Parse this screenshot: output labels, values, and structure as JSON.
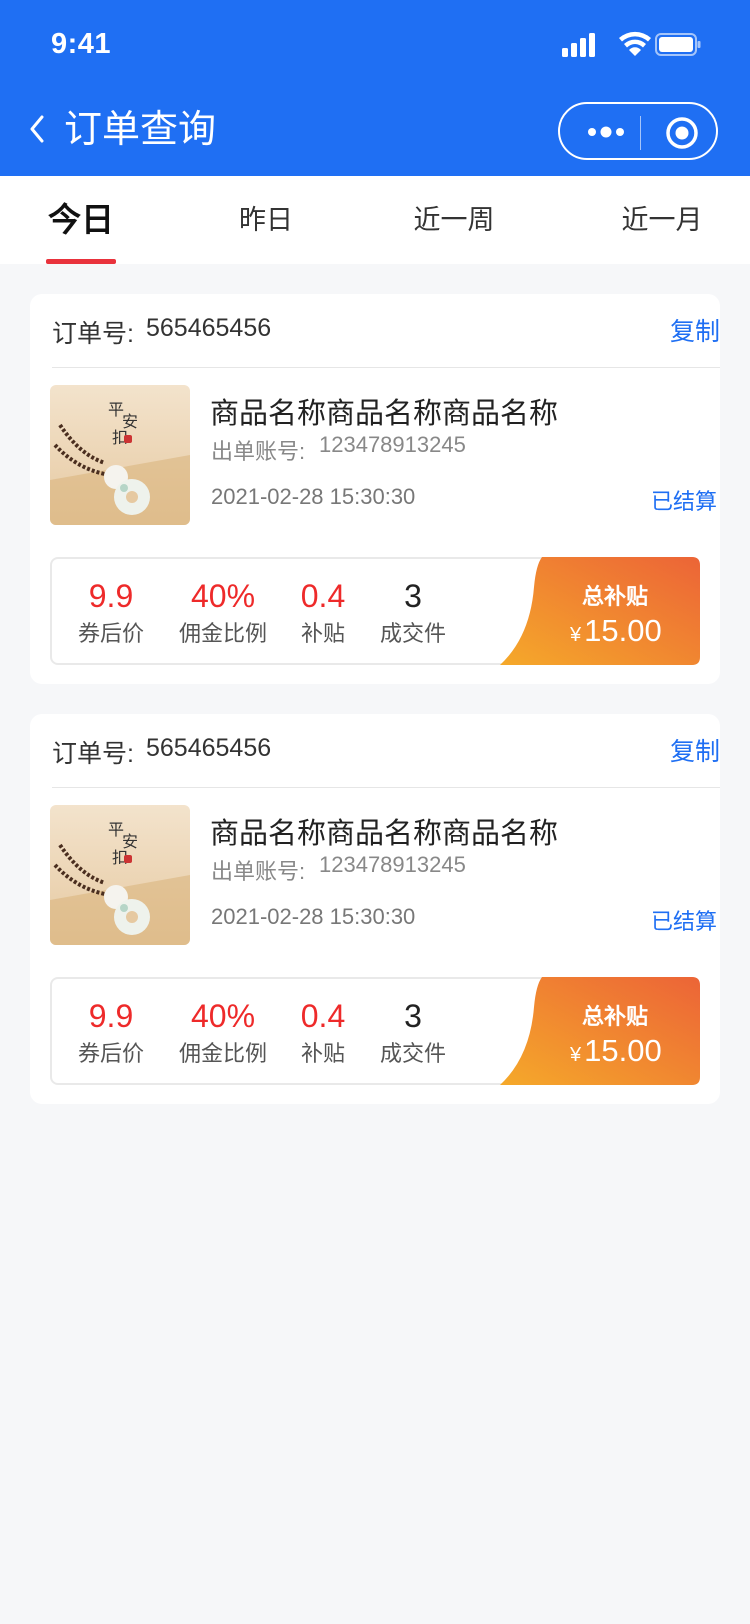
{
  "status_bar": {
    "time": "9:41"
  },
  "nav": {
    "title": "订单查询"
  },
  "tabs": [
    {
      "label": "今日",
      "active": true
    },
    {
      "label": "昨日",
      "active": false
    },
    {
      "label": "近一周",
      "active": false
    },
    {
      "label": "近一月",
      "active": false
    }
  ],
  "orders": [
    {
      "order_label": "订单号:",
      "order_no": "565465456",
      "copy_label": "复制",
      "product_name": "商品名称商品名称商品名称",
      "account_label": "出单账号:",
      "account_no": "123478913245",
      "time": "2021-02-28 15:30:30",
      "status": "已结算",
      "stats": [
        {
          "value": "9.9",
          "label": "券后价"
        },
        {
          "value": "40%",
          "label": "佣金比例"
        },
        {
          "value": "0.4",
          "label": "补贴"
        },
        {
          "value": "3",
          "label": "成交件"
        }
      ],
      "subsidy_label": "总补贴",
      "subsidy_currency": "¥",
      "subsidy_amount": "15.00"
    },
    {
      "order_label": "订单号:",
      "order_no": "565465456",
      "copy_label": "复制",
      "product_name": "商品名称商品名称商品名称",
      "account_label": "出单账号:",
      "account_no": "123478913245",
      "time": "2021-02-28 15:30:30",
      "status": "已结算",
      "stats": [
        {
          "value": "9.9",
          "label": "券后价"
        },
        {
          "value": "40%",
          "label": "佣金比例"
        },
        {
          "value": "0.4",
          "label": "补贴"
        },
        {
          "value": "3",
          "label": "成交件"
        }
      ],
      "subsidy_label": "总补贴",
      "subsidy_currency": "¥",
      "subsidy_amount": "15.00"
    }
  ],
  "colors": {
    "primary": "#1f6ff3",
    "accent_red": "#ee2a2a",
    "tab_indicator": "#e9323c",
    "subsidy_gradient": [
      "#ee6a38",
      "#f4a42c"
    ]
  },
  "product_image_text": "平安扣"
}
